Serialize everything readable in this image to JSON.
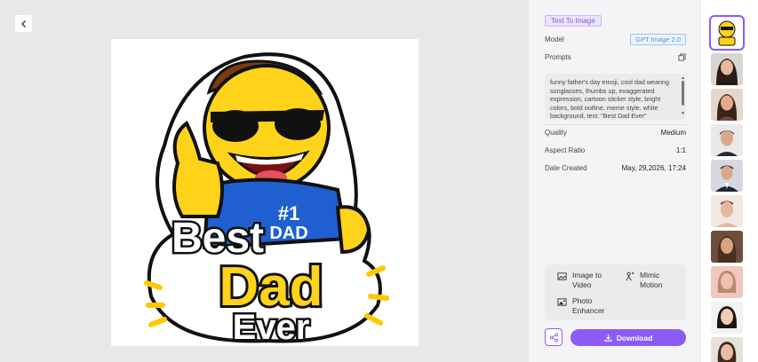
{
  "canvas": {
    "back_icon": "chevron-left-icon",
    "image_text": {
      "line1": "Best",
      "line2": "Dad",
      "line3": "Ever",
      "shirt_num": "#1",
      "shirt_word": "DAD"
    }
  },
  "panel": {
    "mode_tag": "Text To Image",
    "model_label": "Model",
    "model_value": "GPT Image 2.0",
    "prompts_label": "Prompts",
    "prompt_text": "funny father's day emoji, cool dad wearing sunglasses, thumbs up, exaggerated expression, cartoon sticker style, bright colors, bold outline, meme style, white background, text: \"Best Dad Ever\"",
    "quality_label": "Quality",
    "quality_value": "Medium",
    "aspect_label": "Aspect Ratio",
    "aspect_value": "1:1",
    "date_label": "Date Created",
    "date_value": "May, 29,2026, 17:24",
    "tools": {
      "image_to_video": "Image to Video",
      "mimic_motion": "Mimic Motion",
      "photo_enhancer": "Photo Enhancer"
    },
    "download_label": "Download"
  },
  "colors": {
    "accent": "#8a5cf5",
    "tag_bg": "#ebe3fb",
    "model_badge": "#5a8fd0"
  },
  "thumbnails": [
    "emoji-sticker",
    "portrait-woman-1",
    "portrait-woman-2",
    "portrait-man-1",
    "portrait-man-2",
    "portrait-man-3",
    "portrait-woman-3",
    "portrait-woman-4",
    "portrait-woman-5",
    "portrait-woman-6"
  ]
}
